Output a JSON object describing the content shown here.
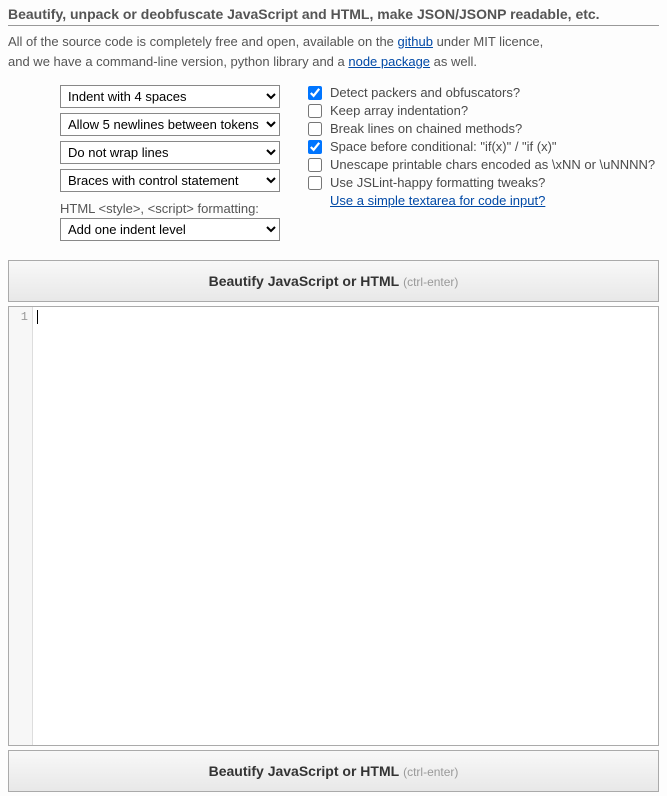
{
  "header": {
    "title": "Beautify, unpack or deobfuscate JavaScript and HTML, make JSON/JSONP readable, etc.",
    "intro_part1": "All of the source code is completely free and open, available on the ",
    "link_github": "github",
    "intro_part2": " under MIT licence,",
    "intro_part3": "and we have a command-line version, python library and a ",
    "link_node": "node package",
    "intro_part4": " as well."
  },
  "selects": {
    "indent": "Indent with 4 spaces",
    "newlines": "Allow 5 newlines between tokens",
    "wrap": "Do not wrap lines",
    "braces": "Braces with control statement",
    "html_label": "HTML <style>, <script> formatting:",
    "html_format": "Add one indent level"
  },
  "checks": {
    "detect": {
      "label": "Detect packers and obfuscators?",
      "checked": true
    },
    "keep_array": {
      "label": "Keep array indentation?",
      "checked": false
    },
    "break_chained": {
      "label": "Break lines on chained methods?",
      "checked": false
    },
    "space_cond": {
      "label": "Space before conditional: \"if(x)\" / \"if (x)\"",
      "checked": true
    },
    "unescape": {
      "label": "Unescape printable chars encoded as \\xNN or \\uNNNN?",
      "checked": false
    },
    "jslint": {
      "label": "Use JSLint-happy formatting tweaks?",
      "checked": false
    },
    "textarea_link": "Use a simple textarea for code input?"
  },
  "button": {
    "label": "Beautify JavaScript or HTML",
    "hint": "(ctrl-enter)"
  },
  "editor": {
    "line1": "1"
  }
}
